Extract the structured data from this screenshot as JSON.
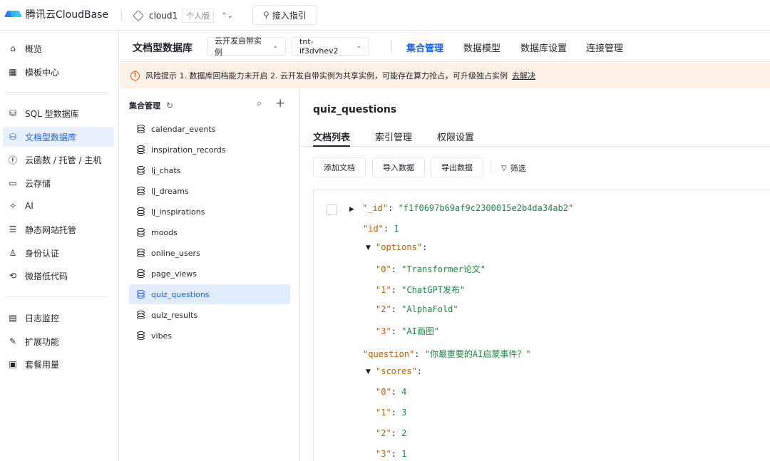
{
  "topbar": {
    "brand": "腾讯云CloudBase",
    "env_name": "cloud1",
    "env_badge": "个人版",
    "guide_label": "接入指引"
  },
  "sidebar": {
    "items": [
      {
        "label": "概览",
        "icon": "home-icon",
        "glyph": "⌂"
      },
      {
        "label": "模板中心",
        "icon": "template-icon",
        "glyph": "▦"
      },
      {
        "label": "SQL 型数据库",
        "icon": "sql-db-icon",
        "glyph": "⛁"
      },
      {
        "label": "文档型数据库",
        "icon": "doc-db-icon",
        "glyph": "⛁"
      },
      {
        "label": "云函数 / 托管 / 主机",
        "icon": "function-icon",
        "glyph": "ⓕ"
      },
      {
        "label": "云存储",
        "icon": "storage-icon",
        "glyph": "▭"
      },
      {
        "label": "AI",
        "icon": "ai-sparkle-icon",
        "glyph": "✧"
      },
      {
        "label": "静态网站托管",
        "icon": "website-icon",
        "glyph": "☰"
      },
      {
        "label": "身份认证",
        "icon": "user-auth-icon",
        "glyph": "♙"
      },
      {
        "label": "微搭低代码",
        "icon": "lowcode-icon",
        "glyph": "⟲"
      },
      {
        "label": "日志监控",
        "icon": "log-icon",
        "glyph": "▤"
      },
      {
        "label": "扩展功能",
        "icon": "extension-icon",
        "glyph": "✎"
      },
      {
        "label": "套餐用量",
        "icon": "package-icon",
        "glyph": "▣"
      }
    ],
    "active_index": 3
  },
  "header": {
    "title": "文档型数据库",
    "instance_select": "云开发自带实例",
    "env_select": "tnt-if3dvhev2",
    "tabs": [
      "集合管理",
      "数据模型",
      "数据库设置",
      "连接管理"
    ],
    "active_tab": 0
  },
  "alert": {
    "text": "风险提示  1. 数据库回档能力未开启  2. 云开发自带实例为共享实例，可能存在算力抢占，可升级独占实例",
    "link": "去解决",
    "accent": "#e8590c"
  },
  "collections": {
    "title": "集合管理",
    "items": [
      "calendar_events",
      "inspiration_records",
      "lj_chats",
      "lj_dreams",
      "lj_inspirations",
      "moods",
      "online_users",
      "page_views",
      "quiz_questions",
      "quiz_results",
      "vibes"
    ],
    "active_index": 8
  },
  "main": {
    "collection_name": "quiz_questions",
    "tabs": [
      "文档列表",
      "索引管理",
      "权限设置"
    ],
    "buttons": {
      "add": "添加文档",
      "import": "导入数据",
      "export": "导出数据",
      "filter": "筛选"
    }
  },
  "document": {
    "id_key": "\"_id\"",
    "id_value": "\"f1f0697b69af9c2300015e2b4da34ab2\"",
    "lines": [
      {
        "key": "\"id\"",
        "value": "1"
      },
      {
        "key": "\"options\"",
        "value": ""
      },
      {
        "key": "\"0\"",
        "value": "\"Transformer论文\""
      },
      {
        "key": "\"1\"",
        "value": "\"ChatGPT发布\""
      },
      {
        "key": "\"2\"",
        "value": "\"AlphaFold\""
      },
      {
        "key": "\"3\"",
        "value": "\"AI画图\""
      },
      {
        "key": "\"question\"",
        "value": "\"你最重要的AI启蒙事件？\""
      },
      {
        "key": "\"scores\"",
        "value": ""
      },
      {
        "key": "\"0\"",
        "value": "4"
      },
      {
        "key": "\"1\"",
        "value": "3"
      },
      {
        "key": "\"2\"",
        "value": "2"
      },
      {
        "key": "\"3\"",
        "value": "1"
      }
    ]
  },
  "colors": {
    "primary": "#1a5ff5",
    "key": "#c15d00",
    "string": "#1b8a3f"
  }
}
